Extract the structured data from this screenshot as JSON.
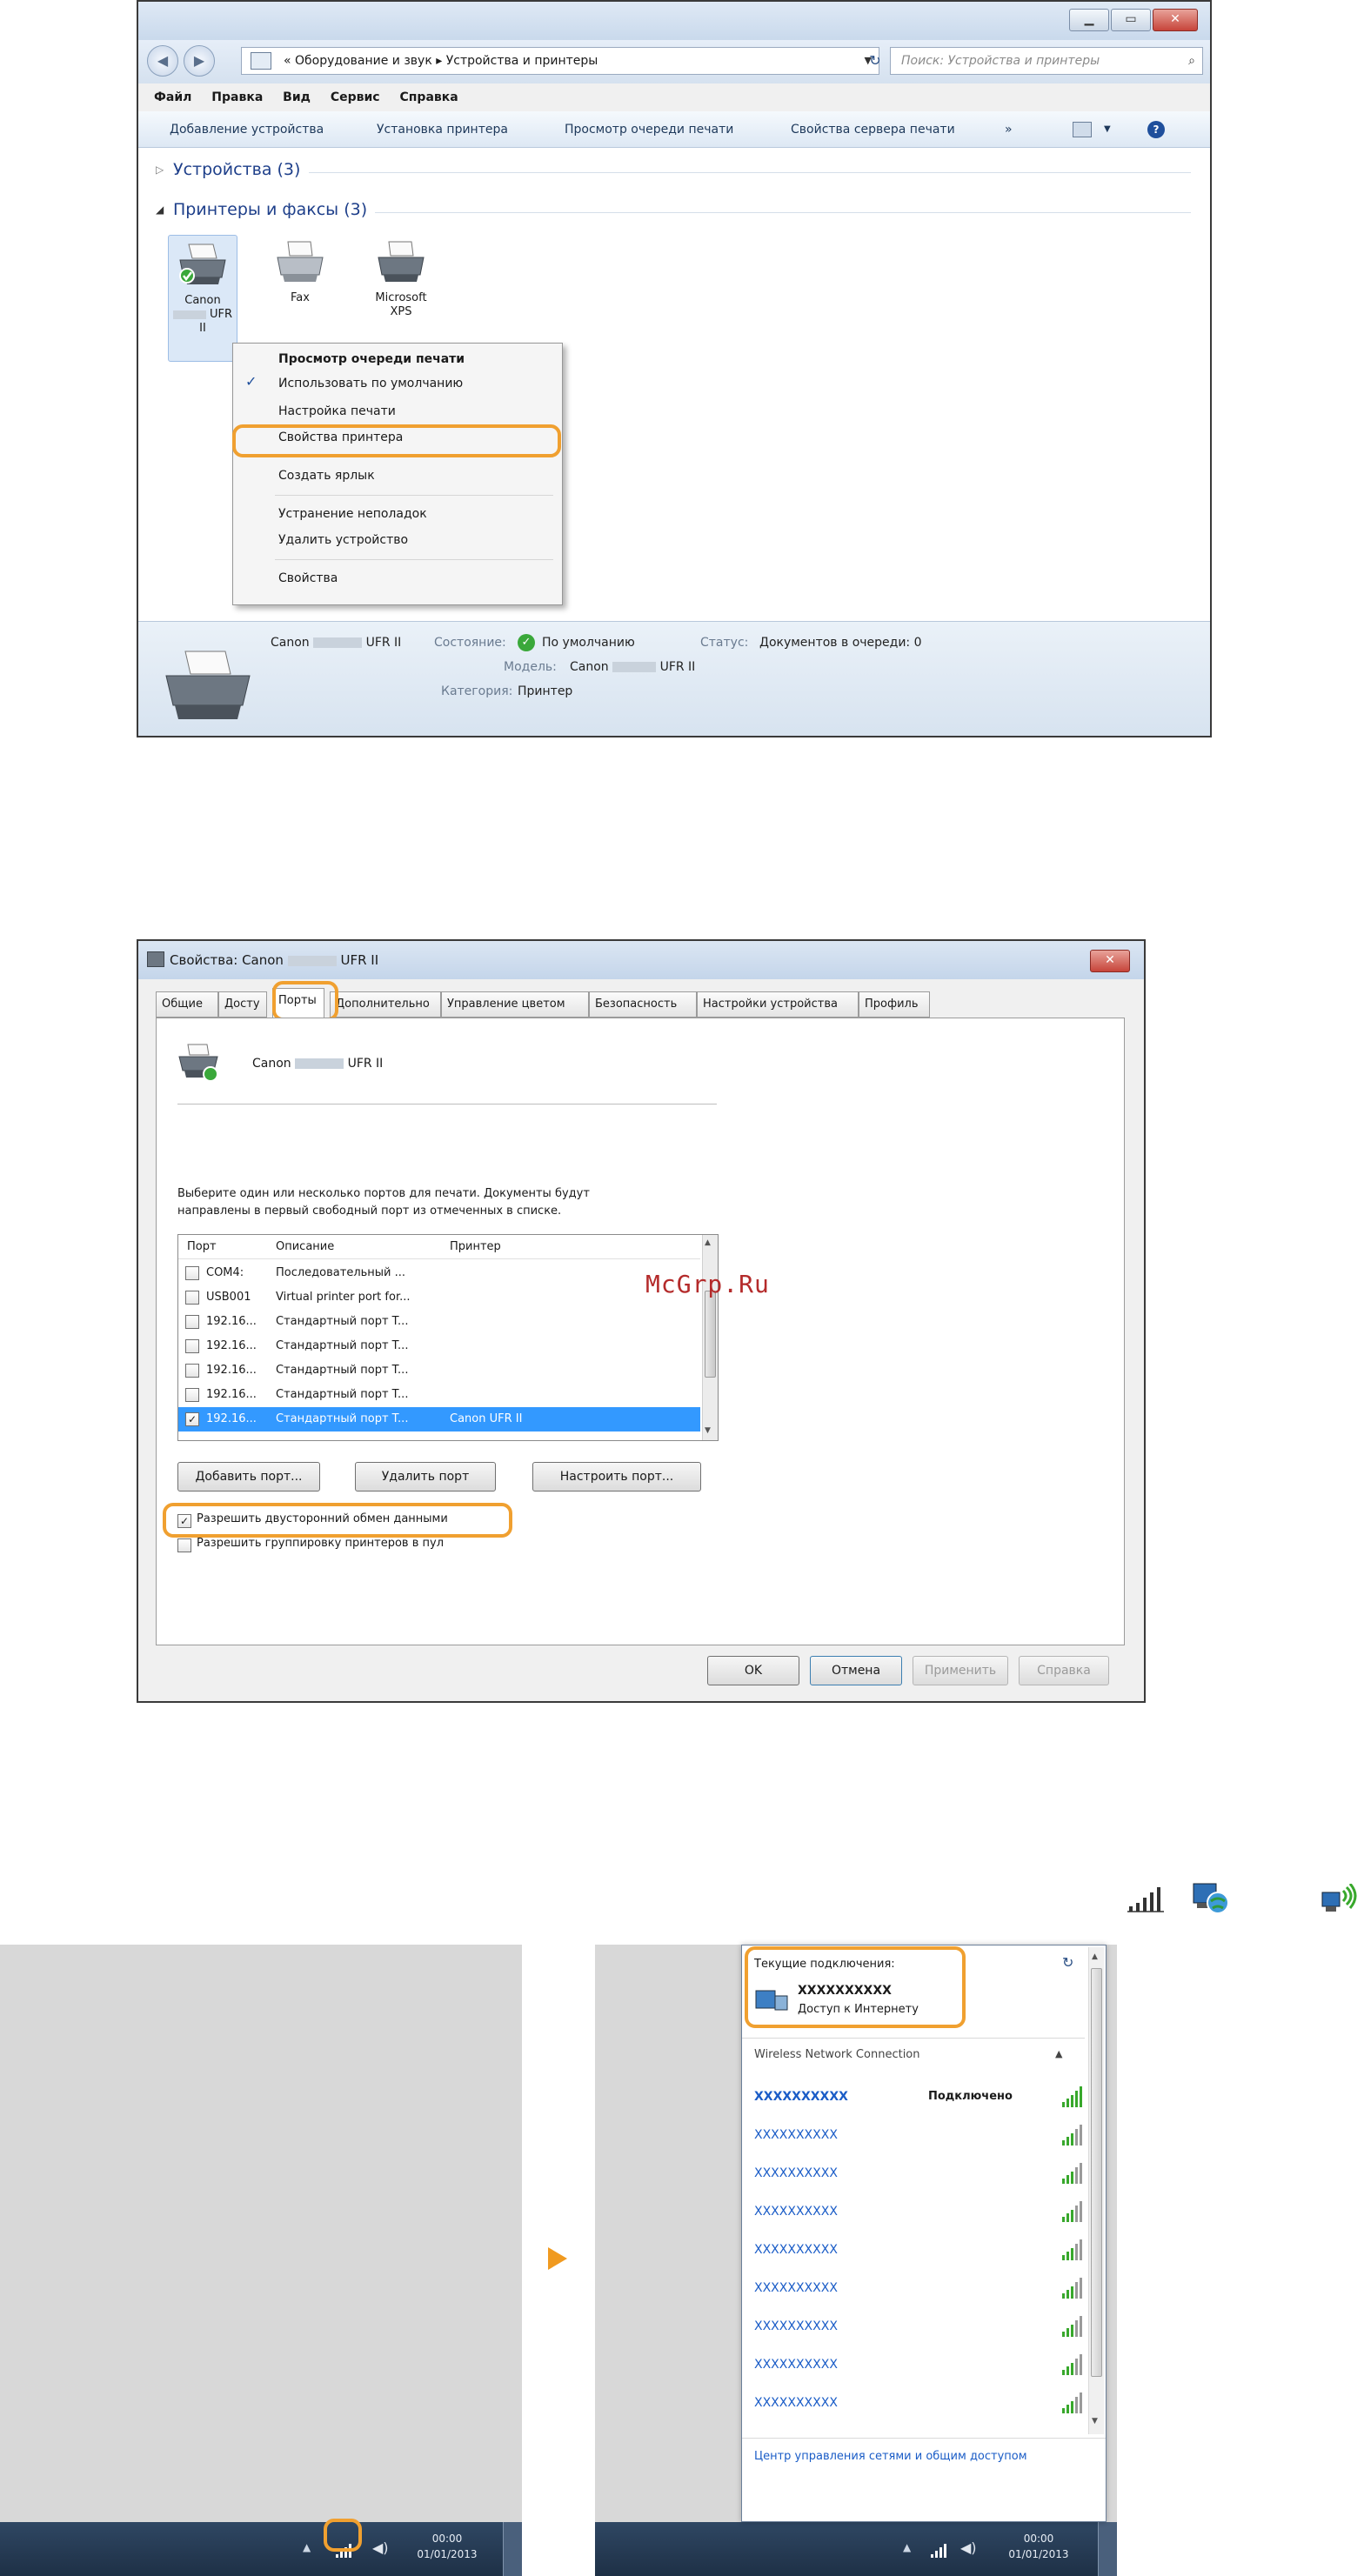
{
  "window1": {
    "address_crumbs": "« Оборудование и звук ▸ Устройства и принтеры",
    "search_placeholder": "Поиск: Устройства и принтеры",
    "menu": [
      "Файл",
      "Правка",
      "Вид",
      "Сервис",
      "Справка"
    ],
    "commands": [
      "Добавление устройства",
      "Установка принтера",
      "Просмотр очереди печати",
      "Свойства сервера печати",
      "»"
    ],
    "group_devices": "Устройства (3)",
    "group_printers": "Принтеры и факсы (3)",
    "printers": [
      {
        "label_line1": "Canon",
        "label_line2": "UFR",
        "label_line3": "II"
      },
      {
        "label_line1": "Fax",
        "label_line2": "",
        "label_line3": ""
      },
      {
        "label_line1": "Microsoft",
        "label_line2": "XPS",
        "label_line3": ""
      }
    ],
    "context_menu": [
      "Просмотр очереди печати",
      "Использовать по умолчанию",
      "Настройка печати",
      "Свойства принтера",
      "Создать ярлык",
      "Устранение неполадок",
      "Удалить устройство",
      "Свойства"
    ],
    "details": {
      "name_prefix": "Canon",
      "name_suffix": "UFR II",
      "state_label": "Состояние:",
      "state_value": "По умолчанию",
      "status_label": "Статус:",
      "status_value": "Документов в очереди: 0",
      "model_label": "Модель:",
      "model_prefix": "Canon",
      "model_suffix": "UFR II",
      "category_label": "Категория:",
      "category_value": "Принтер"
    }
  },
  "window2": {
    "title_prefix": "Свойства: Canon",
    "title_suffix": "UFR II",
    "tabs": [
      "Общие",
      "Досту",
      "Порты",
      "Дополнительно",
      "Управление цветом",
      "Безопасность",
      "Настройки устройства",
      "Профиль"
    ],
    "printer_prefix": "Canon",
    "printer_suffix": "UFR II",
    "instruction_line1": "Выберите один или несколько портов для печати. Документы будут",
    "instruction_line2": "направлены в первый свободный порт из отмеченных в списке.",
    "columns": [
      "Порт",
      "Описание",
      "Принтер"
    ],
    "ports": [
      {
        "port": "COM4:",
        "desc": "Последовательный ...",
        "printer": ""
      },
      {
        "port": "USB001",
        "desc": "Virtual printer port for...",
        "printer": ""
      },
      {
        "port": "192.16...",
        "desc": "Стандартный порт T...",
        "printer": ""
      },
      {
        "port": "192.16...",
        "desc": "Стандартный порт T...",
        "printer": ""
      },
      {
        "port": "192.16...",
        "desc": "Стандартный порт T...",
        "printer": ""
      },
      {
        "port": "192.16...",
        "desc": "Стандартный порт T...",
        "printer": ""
      },
      {
        "port": "192.16...",
        "desc": "Стандартный порт T...",
        "printer": "Canon UFR II"
      }
    ],
    "btn_add": "Добавить порт...",
    "btn_delete": "Удалить порт",
    "btn_config": "Настроить порт...",
    "chk_bidi": "Разрешить двусторонний обмен данными",
    "chk_pool": "Разрешить группировку принтеров в пул",
    "btn_ok": "OK",
    "btn_cancel": "Отмена",
    "btn_apply": "Применить",
    "btn_help": "Справка"
  },
  "watermark": "McGrp.Ru",
  "network": {
    "current_title": "Текущие подключения:",
    "current_name": "XXXXXXXXXX",
    "current_status": "Доступ к Интернету",
    "section": "Wireless Network Connection",
    "connected_label": "Подключено",
    "networks": [
      "XXXXXXXXXX",
      "XXXXXXXXXX",
      "XXXXXXXXXX",
      "XXXXXXXXXX",
      "XXXXXXXXXX",
      "XXXXXXXXXX",
      "XXXXXXXXXX",
      "XXXXXXXXXX",
      "XXXXXXXXXX"
    ],
    "footer_link": "Центр управления сетями и общим доступом",
    "clock_time": "00:00",
    "clock_date": "01/01/2013"
  }
}
